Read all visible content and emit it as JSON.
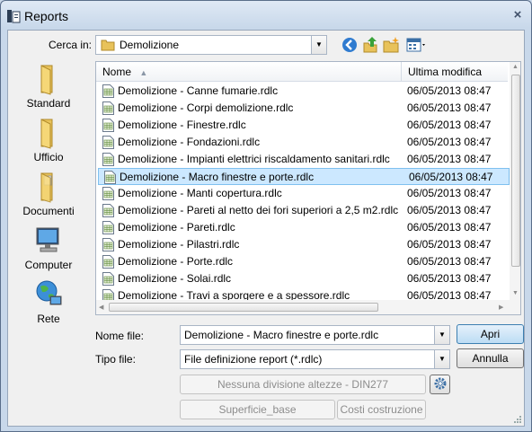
{
  "window": {
    "title": "Reports",
    "close_label": "×"
  },
  "lookin": {
    "label": "Cerca in:",
    "value": "Demolizione"
  },
  "places": [
    {
      "label": "Standard"
    },
    {
      "label": "Ufficio"
    },
    {
      "label": "Documenti"
    },
    {
      "label": "Computer"
    },
    {
      "label": "Rete"
    }
  ],
  "columns": {
    "name": "Nome",
    "modified": "Ultima modifica"
  },
  "files": [
    {
      "name": "Demolizione - Canne fumarie.rdlc",
      "date": "06/05/2013 08:47"
    },
    {
      "name": "Demolizione - Corpi demolizione.rdlc",
      "date": "06/05/2013 08:47"
    },
    {
      "name": "Demolizione - Finestre.rdlc",
      "date": "06/05/2013 08:47"
    },
    {
      "name": "Demolizione - Fondazioni.rdlc",
      "date": "06/05/2013 08:47"
    },
    {
      "name": "Demolizione - Impianti elettrici riscaldamento sanitari.rdlc",
      "date": "06/05/2013 08:47"
    },
    {
      "name": "Demolizione - Macro finestre e porte.rdlc",
      "date": "06/05/2013 08:47"
    },
    {
      "name": "Demolizione - Manti copertura.rdlc",
      "date": "06/05/2013 08:47"
    },
    {
      "name": "Demolizione - Pareti al netto dei fori superiori a 2,5 m2.rdlc",
      "date": "06/05/2013 08:47"
    },
    {
      "name": "Demolizione - Pareti.rdlc",
      "date": "06/05/2013 08:47"
    },
    {
      "name": "Demolizione - Pilastri.rdlc",
      "date": "06/05/2013 08:47"
    },
    {
      "name": "Demolizione - Porte.rdlc",
      "date": "06/05/2013 08:47"
    },
    {
      "name": "Demolizione - Solai.rdlc",
      "date": "06/05/2013 08:47"
    },
    {
      "name": "Demolizione - Travi a sporgere e a spessore.rdlc",
      "date": "06/05/2013 08:47"
    }
  ],
  "selected_index": 5,
  "filename": {
    "label": "Nome file:",
    "value": "Demolizione - Macro finestre e porte.rdlc"
  },
  "filetype": {
    "label": "Tipo file:",
    "value": "File definizione report (*.rdlc)"
  },
  "buttons": {
    "open": "Apri",
    "cancel": "Annulla",
    "height_division": "Nessuna divisione altezze - DIN277",
    "surface": "Superficie_base",
    "costs": "Costi costruzione"
  },
  "colors": {
    "selection": "#cce8ff",
    "selection_border": "#7fc0ef",
    "primary_button": "#bcdcf4"
  }
}
